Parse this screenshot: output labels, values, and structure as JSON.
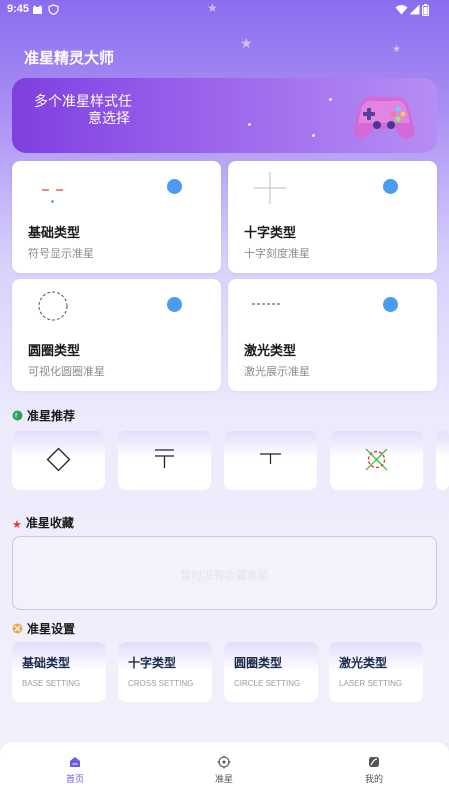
{
  "status_bar": {
    "time": "9:45"
  },
  "app_title": "准星精灵大师",
  "banner": {
    "line1": "多个准星样式任",
    "line2": "意选择"
  },
  "type_cards": [
    {
      "title": "基础类型",
      "subtitle": "符号显示准星"
    },
    {
      "title": "十字类型",
      "subtitle": "十字刻度准星"
    },
    {
      "title": "圆圈类型",
      "subtitle": "可视化圆圈准星"
    },
    {
      "title": "激光类型",
      "subtitle": "激光展示准星"
    }
  ],
  "sections": {
    "recommend": "准星推荐",
    "favorites": "准星收藏",
    "settings": "准星设置"
  },
  "favorites_empty": "暂时没有收藏准星",
  "settings_items": [
    {
      "title": "基础类型",
      "subtitle": "BASE SETTING"
    },
    {
      "title": "十字类型",
      "subtitle": "CROSS SETTING"
    },
    {
      "title": "圆圈类型",
      "subtitle": "CIRCLE SETTING"
    },
    {
      "title": "激光类型",
      "subtitle": "LASER SETTING"
    }
  ],
  "tabs": [
    {
      "label": "首页",
      "icon": "home-icon",
      "active": true
    },
    {
      "label": "准星",
      "icon": "crosshair-icon",
      "active": false
    },
    {
      "label": "我的",
      "icon": "profile-icon",
      "active": false
    }
  ],
  "colors": {
    "accent": "#6a5be8",
    "toggle": "#4a9cf2",
    "banner_start": "#7f3fe0",
    "banner_end": "#b58ef4"
  }
}
